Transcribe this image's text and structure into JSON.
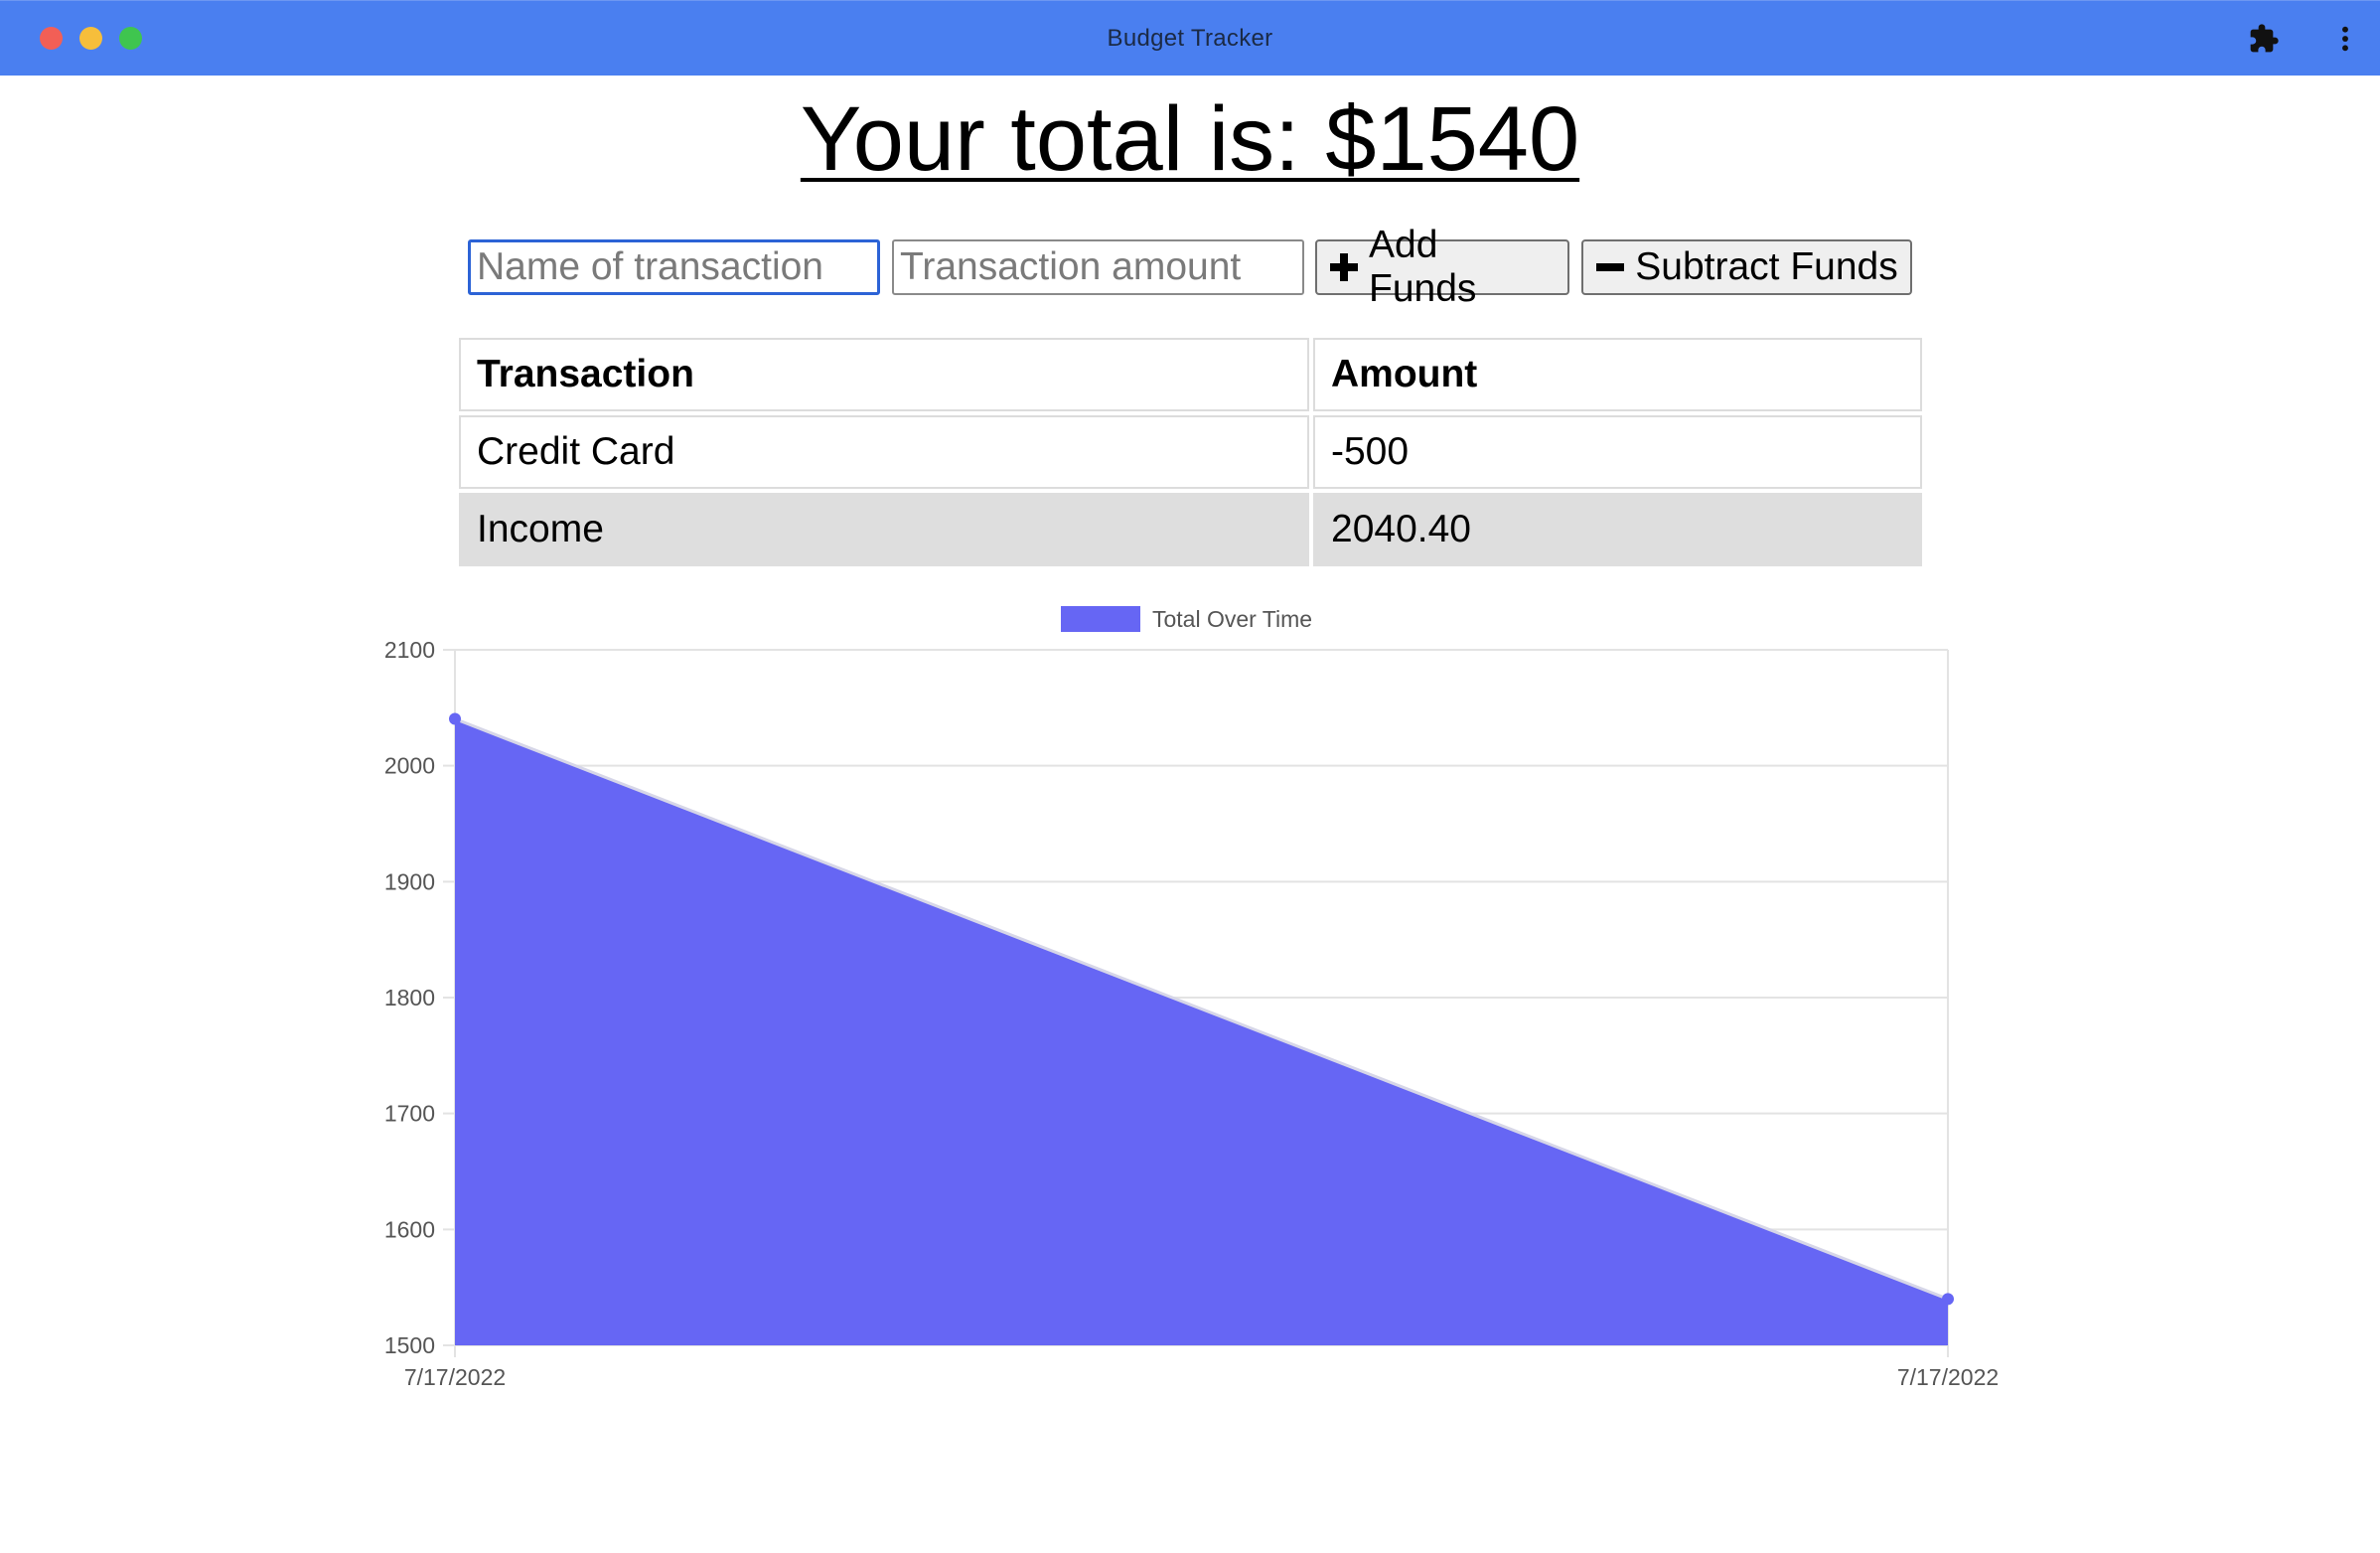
{
  "window": {
    "title": "Budget Tracker"
  },
  "header": {
    "total_text": "Your total is: $1540"
  },
  "form": {
    "name_placeholder": "Name of transaction",
    "amount_placeholder": "Transaction amount",
    "add_label": "Add Funds",
    "subtract_label": "Subtract Funds"
  },
  "table": {
    "headers": [
      "Transaction",
      "Amount"
    ],
    "rows": [
      {
        "name": "Credit Card",
        "amount": "-500"
      },
      {
        "name": "Income",
        "amount": "2040.40"
      }
    ]
  },
  "chart_data": {
    "type": "area",
    "title": "",
    "xlabel": "",
    "ylabel": "",
    "legend": "top",
    "grid": true,
    "x": [
      "7/17/2022",
      "7/17/2022"
    ],
    "series": [
      {
        "name": "Total Over Time",
        "values": [
          2040.4,
          1540
        ],
        "color": "#6666f4"
      }
    ],
    "ylim": [
      1500,
      2100
    ],
    "yticks": [
      1500,
      1600,
      1700,
      1800,
      1900,
      2000,
      2100
    ]
  }
}
